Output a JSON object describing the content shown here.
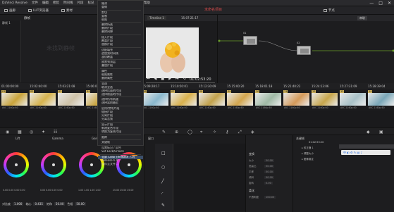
{
  "menu": {
    "items": [
      "DaVinci Resolve",
      "文件",
      "编辑",
      "修剪",
      "时间线",
      "片段",
      "标记",
      "显示",
      "播放",
      "调色",
      "工作区",
      "帮助"
    ],
    "window_controls": [
      "—",
      "□",
      "✕"
    ]
  },
  "toolbar": {
    "gallery_label": "画廊",
    "luts_label": "LUT浏览器",
    "media_label": "素材",
    "project_title": "未命名项目",
    "nodes_label": "节点",
    "tab_label": "时间线"
  },
  "gallery": {
    "header": "静帧",
    "tree_items": [
      "静帧 1"
    ],
    "empty_watermark": "未找到静帧"
  },
  "dropdown": {
    "items": [
      "撤消",
      "重做",
      "---",
      "剪切",
      "复制",
      "粘贴",
      "---",
      "删除所选",
      "删除片段",
      "删除间隙",
      "---",
      "插入片段",
      "覆盖片段",
      "替换片段",
      "---",
      "适配填充",
      "追加到时间线",
      "波纹覆盖",
      "---",
      "放置到顶层",
      "叠加片段",
      "---",
      "属性",
      "粘贴属性",
      "删除属性",
      "---",
      "全选",
      "取消全选",
      "选择后面的片段",
      "选择前面的片段",
      "---",
      "选择所有轨道",
      "选择离前最近",
      "---",
      "启用/禁用片段",
      "链接片段",
      "分离片段",
      "分离音频",
      "---",
      "显示片段",
      "新建复合片段",
      "转换为复合片段",
      "---",
      "跟踪",
      "---",
      "关键帧",
      "---",
      "设置标记 / 反色",
      "Set Lock/Unlock",
      "---",
      "全屏 Color (Release 7.0)",
      "Release 6.0",
      "保存至文件..."
    ],
    "selected_index": 50
  },
  "viewer": {
    "clip_name": "Timeline 1",
    "source_tc": "15:07:21:17",
    "record_tc": "01:02:53:20",
    "transport": [
      "⏮",
      "◀",
      "■",
      "▶",
      "⏭",
      "⟲"
    ]
  },
  "nodes": {
    "mode_label": "串联",
    "node_labels": [
      "01",
      "02"
    ]
  },
  "timeline": {
    "header_timecodes": [
      "01:00:00:00",
      "15:02:40:00",
      "15:03:21:08",
      "15:06:03:09",
      "15:07:21:04",
      "15:09:28:17",
      "15:10:50:01",
      "15:12:30:09",
      "15:15:00:20",
      "15:18:01:18",
      "15:21:40:22",
      "15:24:13:06",
      "15:27:31:09",
      "15:28:39:04"
    ],
    "clips": [
      {
        "num": "01",
        "tc": "00:01:02:05",
        "caption": "AVC  2160p 60",
        "color": "#caa43a"
      },
      {
        "num": "02",
        "tc": "00:01:10:00",
        "caption": "AVC  2160p 60",
        "color": "#d6b34d"
      },
      {
        "num": "03",
        "tc": "00:01:18:10",
        "caption": "AVC  2160p 60",
        "color": "#cfc3a8"
      },
      {
        "num": "04",
        "tc": "00:01:25:02",
        "caption": "AVC  2160p 60",
        "color": "#c9a540"
      },
      {
        "num": "05",
        "tc": "00:01:32:20",
        "caption": "AVC  2160p 60",
        "color": "#7fb0c8"
      },
      {
        "num": "06",
        "tc": "00:01:40:11",
        "caption": "AVC  2160p 60",
        "color": "#8ab8cd"
      },
      {
        "num": "07",
        "tc": "00:01:47:09",
        "caption": "AVC  2160p 60",
        "color": "#d9b14c"
      },
      {
        "num": "08",
        "tc": "00:01:54:14",
        "caption": "AVC  2160p 60",
        "color": "#c2a24b"
      },
      {
        "num": "09",
        "tc": "00:02:02:21",
        "caption": "AVC  2160p 60",
        "color": "#d3a64e"
      },
      {
        "num": "10",
        "tc": "00:02:09:01",
        "caption": "AVC  2160p 60",
        "color": "#9fb9a5"
      },
      {
        "num": "11",
        "tc": "00:02:17:10",
        "caption": "AVC  2160p 60",
        "color": "#d49a5a"
      },
      {
        "num": "12",
        "tc": "00:02:24:18",
        "caption": "AVC  2160p 60",
        "color": "#c7a64b"
      },
      {
        "num": "13",
        "tc": "00:02:31:04",
        "caption": "AVC  2160p 60",
        "color": "#a9c2c8"
      },
      {
        "num": "14",
        "tc": "00:02:38:19",
        "caption": "AVC  2160p 60",
        "color": "#7aa7b8"
      }
    ]
  },
  "wheels": {
    "labels": [
      "Lift",
      "Gamma",
      "Gain",
      "偏移"
    ],
    "values": [
      [
        "0.00",
        "0.00",
        "0.00",
        "0.00"
      ],
      [
        "0.00",
        "0.00",
        "0.00",
        "0.00"
      ],
      [
        "1.00",
        "1.00",
        "1.00",
        "1.00"
      ],
      [
        "25.00",
        "25.00",
        "25.00",
        "25.00"
      ]
    ],
    "footer": {
      "contrast_label": "对比度",
      "contrast": "1.000",
      "pivot_label": "轴心",
      "pivot": "0.435",
      "sat_label": "饱和",
      "sat": "50.00",
      "hue_label": "色相",
      "hue": "50.00",
      "lum_label": "亮度混合",
      "lum": "100.00"
    }
  },
  "shapes": {
    "header": "窗口",
    "tools": [
      "□",
      "○",
      "╱",
      "◜",
      "✎"
    ],
    "hint": ""
  },
  "props": {
    "header1": "变换",
    "header2": "柔化",
    "field_labels": [
      "大小",
      "宽高比",
      "平移",
      "倾斜",
      "旋转",
      "不透明度"
    ],
    "field_values": [
      "50.00",
      "50.00",
      "50.00",
      "50.00",
      "0.00",
      "100.00"
    ]
  },
  "keyframes": {
    "header": "关键帧",
    "tc": "01:02:53:20",
    "rows": [
      "▸ 校正器 1",
      "▸ 调整大小",
      "▸ 图像稳定"
    ],
    "ime_text": "中 ◐ ⚙ ✎ ▤ ♪"
  }
}
